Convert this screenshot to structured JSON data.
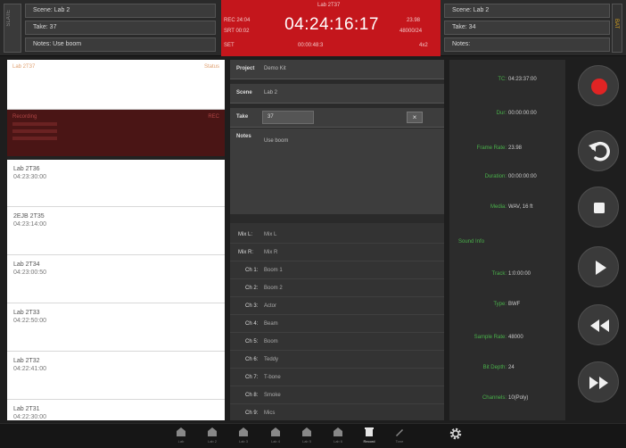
{
  "topbar": {
    "side_label": "SLATE",
    "left_fields": [
      "Scene: Lab 2",
      "Take: 37",
      "Notes: Use boom"
    ],
    "right_fields": [
      "Scene: Lab 2",
      "Take: 34",
      "Notes:"
    ],
    "edge_label": "BAT"
  },
  "timecode": {
    "main": "04:24:16:17",
    "top_center": "Lab 2T37",
    "left_1": "REC 24:04",
    "left_2": "SRT 00:02",
    "left_3": "SET",
    "right_1": "23.98",
    "right_2": "48000/24",
    "right_3": "4x2",
    "bottom_center": "00:00:48:3"
  },
  "clips": {
    "active": {
      "name": "Lab 2T37",
      "right": "Status"
    },
    "recording": {
      "name": "Recording",
      "right": "REC"
    },
    "items": [
      {
        "name": "Lab 2T36",
        "time": "04:23:30:00"
      },
      {
        "name": "2EJB 2T35",
        "time": "04:23:14:00"
      },
      {
        "name": "Lab 2T34",
        "time": "04:23:00:50"
      },
      {
        "name": "Lab 2T33",
        "time": "04:22:50:00"
      },
      {
        "name": "Lab 2T32",
        "time": "04:22:41:00"
      },
      {
        "name": "Lab 2T31",
        "time": "04:22:30:00"
      }
    ]
  },
  "meta": {
    "project_label": "Project",
    "project_value": "Demo Kit",
    "scene_label": "Scene",
    "scene_value": "Lab 2",
    "take_label": "Take",
    "take_value": "37",
    "clear_label": "×",
    "notes_label": "Notes",
    "notes_value": "Use boom",
    "tracks": [
      {
        "label": "Mix L:",
        "value": "Mix L",
        "indent": false
      },
      {
        "label": "Mix R:",
        "value": "Mix R",
        "indent": false
      },
      {
        "label": "Ch 1:",
        "value": "Boom 1",
        "indent": true
      },
      {
        "label": "Ch 2:",
        "value": "Boom 2",
        "indent": true
      },
      {
        "label": "Ch 3:",
        "value": "Actor",
        "indent": true
      },
      {
        "label": "Ch 4:",
        "value": "Beam",
        "indent": true
      },
      {
        "label": "Ch 5:",
        "value": "Boom",
        "indent": true
      },
      {
        "label": "Ch 6:",
        "value": "Teddy",
        "indent": true
      },
      {
        "label": "Ch 7:",
        "value": "T-bone",
        "indent": true
      },
      {
        "label": "Ch 8:",
        "value": "Smoke",
        "indent": true
      },
      {
        "label": "Ch 9:",
        "value": "Mics",
        "indent": true
      }
    ]
  },
  "info": {
    "rows_top": [
      {
        "k": "TC:",
        "v": "04:23:37:00"
      },
      {
        "k": "Dur:",
        "v": "00:00:00:00"
      },
      {
        "k": "Frame Rate:",
        "v": "23.98"
      },
      {
        "k": "Duration:",
        "v": "00:00:00:00"
      },
      {
        "k": "Media:",
        "v": "WAV, 16 ft"
      }
    ],
    "section_head": "Sound Info",
    "rows_bottom": [
      {
        "k": "Track:",
        "v": "1:0:00:00"
      },
      {
        "k": "Type:",
        "v": "BWF"
      },
      {
        "k": "Sample Rate:",
        "v": "48000"
      },
      {
        "k": "Bit Depth:",
        "v": "24"
      },
      {
        "k": "Channels:",
        "v": "10(Poly)"
      }
    ]
  },
  "transport": {
    "record_color": "#e02424",
    "buttons": [
      "record-icon",
      "undo-icon",
      "stop-icon",
      "play-icon",
      "rewind-icon",
      "fast-forward-icon"
    ]
  },
  "tabs": [
    {
      "label": "Lab",
      "icon": "cabinet-icon"
    },
    {
      "label": "Lab 2",
      "icon": "cabinet-icon"
    },
    {
      "label": "Lab 3",
      "icon": "cabinet-icon"
    },
    {
      "label": "Lab 4",
      "icon": "cabinet-icon"
    },
    {
      "label": "Lab 5",
      "icon": "cabinet-icon"
    },
    {
      "label": "Lab 6",
      "icon": "cabinet-icon"
    },
    {
      "label": "Record",
      "icon": "trash-icon",
      "active": true
    },
    {
      "label": "Tone",
      "icon": "pen-icon"
    },
    {
      "label": "",
      "icon": "gear-icon"
    }
  ]
}
